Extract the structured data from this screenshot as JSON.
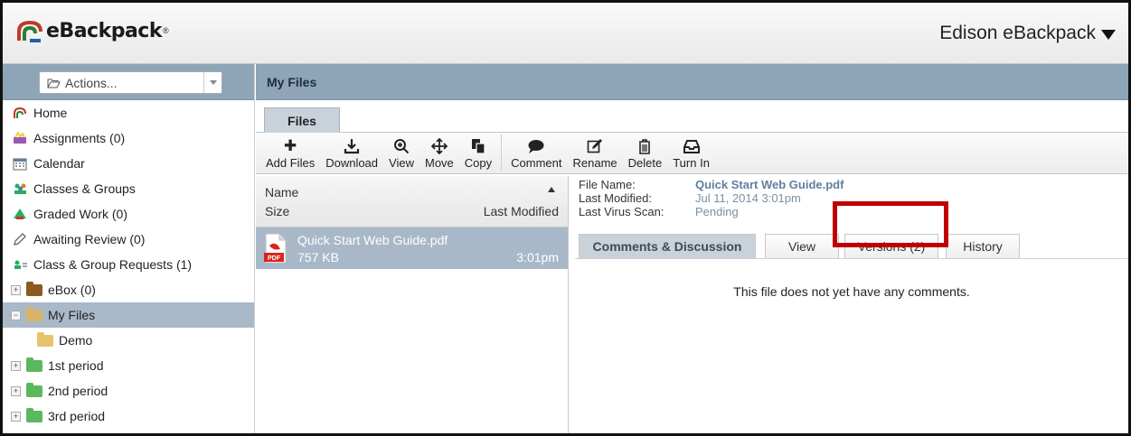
{
  "app": {
    "logo_text": "eBackpack",
    "logo_mark": "®",
    "user_menu": "Edison eBackpack"
  },
  "sidebar": {
    "actions_label": "Actions...",
    "nav": [
      {
        "label": "Home",
        "icon": "home-icon"
      },
      {
        "label": "Assignments (0)",
        "icon": "assignments-icon"
      },
      {
        "label": "Calendar",
        "icon": "calendar-icon"
      },
      {
        "label": "Classes & Groups",
        "icon": "classes-icon"
      },
      {
        "label": "Graded Work (0)",
        "icon": "graded-icon"
      },
      {
        "label": "Awaiting Review (0)",
        "icon": "pencil-icon"
      },
      {
        "label": "Class & Group Requests (1)",
        "icon": "requests-icon"
      }
    ],
    "tree": [
      {
        "label": "eBox (0)",
        "expander": "+",
        "color": "#8b5a1e"
      },
      {
        "label": "My Files",
        "expander": "−",
        "color": "#d9b36a",
        "selected": true
      },
      {
        "label": "Demo",
        "expander": "",
        "color": "#e6c56a"
      },
      {
        "label": "1st period",
        "expander": "+",
        "color": "#5cb85c"
      },
      {
        "label": "2nd period",
        "expander": "+",
        "color": "#5cb85c"
      },
      {
        "label": "3rd period",
        "expander": "+",
        "color": "#5cb85c"
      }
    ]
  },
  "main": {
    "breadcrumb": "My Files",
    "tab_files": "Files",
    "toolbar": {
      "add_files": "Add Files",
      "download": "Download",
      "view": "View",
      "move": "Move",
      "copy": "Copy",
      "comment": "Comment",
      "rename": "Rename",
      "delete": "Delete",
      "turn_in": "Turn In"
    },
    "list": {
      "col_name": "Name",
      "col_size": "Size",
      "col_modified": "Last Modified",
      "file": {
        "name": "Quick Start Web Guide.pdf",
        "size": "757 KB",
        "time": "3:01pm",
        "badge": "PDF"
      }
    },
    "details": {
      "file_name_label": "File Name:",
      "file_name": "Quick Start Web Guide.pdf",
      "modified_label": "Last Modified:",
      "modified": "Jul 11, 2014 3:01pm",
      "scan_label": "Last Virus Scan:",
      "scan": "Pending",
      "tabs": {
        "comments": "Comments & Discussion",
        "view": "View",
        "versions": "Versions (2)",
        "history": "History"
      },
      "empty_message": "This file does not yet have any comments."
    }
  },
  "colors": {
    "highlight": "#c00000",
    "header_bar": "#8ea4b7",
    "selected_row": "#a8b8c8"
  }
}
